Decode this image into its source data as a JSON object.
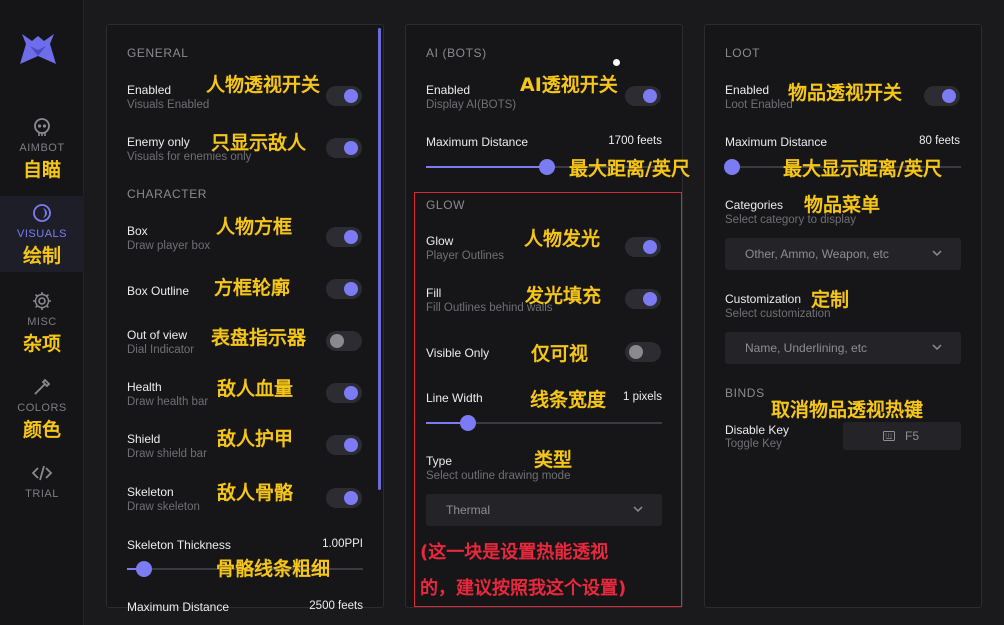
{
  "sidebar": {
    "items": [
      {
        "label": "AIMBOT",
        "cn": "自瞄",
        "icon": "skull-icon"
      },
      {
        "label": "VISUALS",
        "cn": "绘制",
        "icon": "eye-icon"
      },
      {
        "label": "MISC",
        "cn": "杂项",
        "icon": "gear-icon"
      },
      {
        "label": "COLORS",
        "cn": "颜色",
        "icon": "eyedropper-icon"
      },
      {
        "label": "TRIAL",
        "cn": "",
        "icon": "code-icon"
      }
    ]
  },
  "general": {
    "title": "GENERAL",
    "enabled": {
      "label": "Enabled",
      "sub": "Visuals Enabled",
      "anno": "人物透视开关",
      "on": true
    },
    "enemy_only": {
      "label": "Enemy only",
      "sub": "Visuals for enemies only",
      "anno": "只显示敌人",
      "on": true
    }
  },
  "character": {
    "title": "CHARACTER",
    "box": {
      "label": "Box",
      "sub": "Draw player box",
      "anno": "人物方框",
      "on": true
    },
    "box_outline": {
      "label": "Box Outline",
      "anno": "方框轮廓",
      "on": true
    },
    "out_of_view": {
      "label": "Out of view",
      "sub": "Dial Indicator",
      "anno": "表盘指示器",
      "on": false
    },
    "health": {
      "label": "Health",
      "sub": "Draw health bar",
      "anno": "敌人血量",
      "on": true
    },
    "shield": {
      "label": "Shield",
      "sub": "Draw shield bar",
      "anno": "敌人护甲",
      "on": true
    },
    "skeleton": {
      "label": "Skeleton",
      "sub": "Draw skeleton",
      "anno": "敌人骨骼",
      "on": true
    },
    "skeleton_thickness": {
      "label": "Skeleton Thickness",
      "value": "1.00PPI",
      "anno": "骨骼线条粗细",
      "level": 0.07
    },
    "max_distance": {
      "label": "Maximum Distance",
      "value": "2500 feets"
    }
  },
  "ai": {
    "title": "AI (BOTS)",
    "enabled": {
      "label": "Enabled",
      "sub": "Display AI(BOTS)",
      "anno": "AI透视开关",
      "on": true
    },
    "max_distance": {
      "label": "Maximum Distance",
      "value": "1700 feets",
      "anno": "最大距离/英尺",
      "level": 0.5
    }
  },
  "glow": {
    "title": "GLOW",
    "glow": {
      "label": "Glow",
      "sub": "Player Outlines",
      "anno": "人物发光",
      "on": true
    },
    "fill": {
      "label": "Fill",
      "sub": "Fill Outlines behind walls",
      "anno": "发光填充",
      "on": true
    },
    "visible_only": {
      "label": "Visible Only",
      "anno": "仅可视",
      "on": false
    },
    "line_width": {
      "label": "Line Width",
      "value": "1 pixels",
      "anno": "线条宽度",
      "level": 0.18
    },
    "type": {
      "label": "Type",
      "sub": "Select outline drawing mode",
      "anno": "类型",
      "selected": "Thermal"
    },
    "note_line1": "(这一块是设置热能透视",
    "note_line2": "的，建议按照我这个设置)"
  },
  "loot": {
    "title": "LOOT",
    "enabled": {
      "label": "Enabled",
      "sub": "Loot Enabled",
      "anno": "物品透视开关",
      "on": true
    },
    "max_distance": {
      "label": "Maximum Distance",
      "value": "80 feets",
      "anno": "最大显示距离/英尺",
      "level": 0.03
    },
    "categories": {
      "label": "Categories",
      "sub": "Select category to display",
      "anno": "物品菜单",
      "selected": "Other, Ammo, Weapon, etc"
    },
    "customization": {
      "label": "Customization",
      "sub": "Select customization",
      "anno": "定制",
      "selected": "Name, Underlining, etc"
    }
  },
  "binds": {
    "title": "BINDS",
    "anno": "取消物品透视热键",
    "disable_key": {
      "label": "Disable Key",
      "sub": "Toggle Key",
      "key": "F5"
    }
  },
  "colors": {
    "accent": "#7b7bf3",
    "annotation": "#f5c518",
    "highlight_box": "#d42a3a"
  }
}
